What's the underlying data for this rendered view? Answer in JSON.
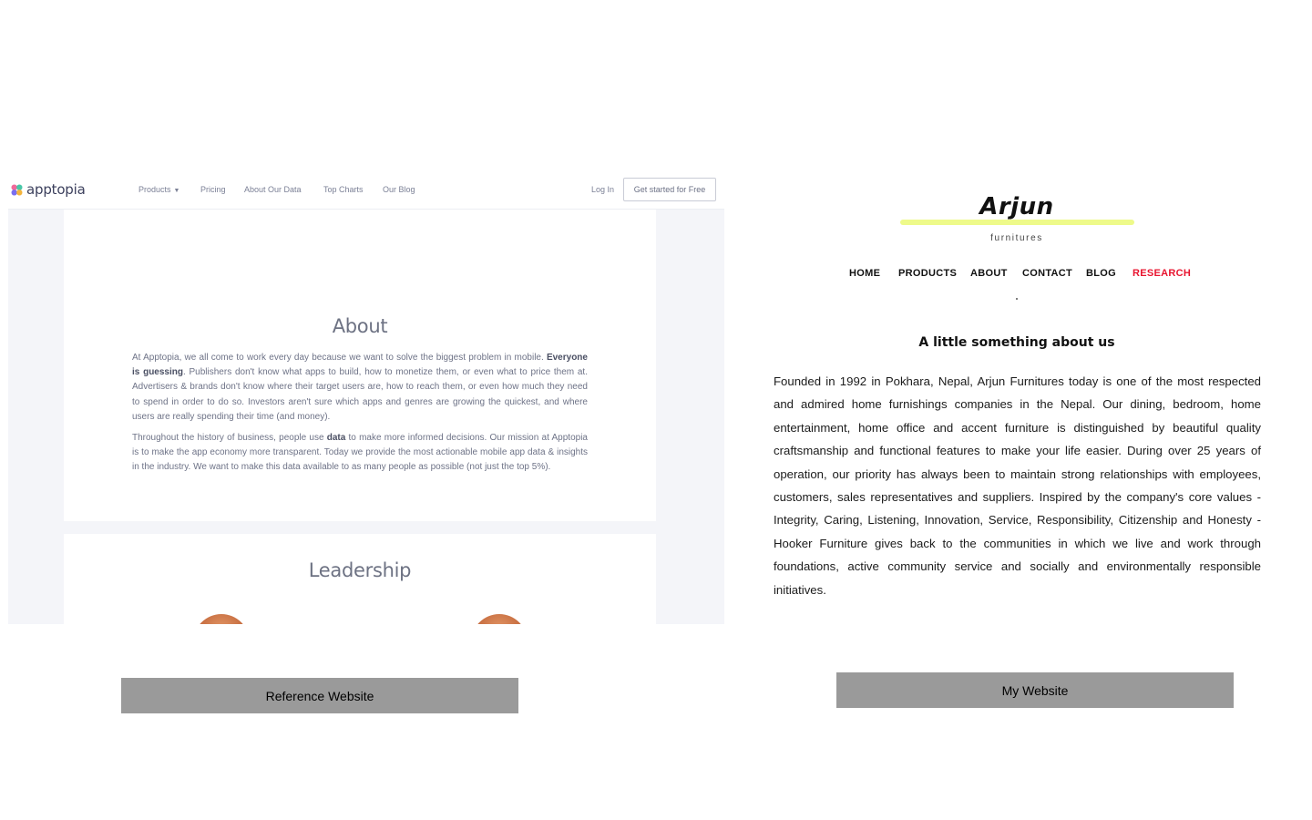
{
  "reference": {
    "logo_text": "apptopia",
    "nav": {
      "products": "Products",
      "pricing": "Pricing",
      "about_data": "About Our Data",
      "top_charts": "Top Charts",
      "blog": "Our Blog",
      "login": "Log In",
      "cta": "Get started for Free"
    },
    "about_title": "About",
    "para1_lead": "At Apptopia, we all come to work every day because we want to solve the biggest problem in mobile.",
    "para1_bold": "Everyone is guessing",
    "para1_rest": ". Publishers don't know what apps to build, how to monetize them, or even what to price them at. Advertisers & brands don't know where their target users are, how to reach them, or even how much they need to spend in order to do so. Investors aren't sure which apps and genres are growing the quickest, and where users are really spending their time (and money).",
    "para2_lead": "Throughout the history of business, people use",
    "para2_bold": "data",
    "para2_rest": "to make more informed decisions. Our mission at Apptopia is to make the app economy more transparent. Today we provide the most actionable mobile app data & insights in the industry. We want to make this data available to as many people as possible (not just the top 5%).",
    "leadership_title": "Leadership"
  },
  "labels": {
    "reference": "Reference Website",
    "mine": "My Website"
  },
  "mysite": {
    "brand": "Arjun",
    "tagline": "furnitures",
    "nav": [
      "HOME",
      "PRODUCTS",
      "ABOUT",
      "CONTACT",
      "BLOG",
      "RESEARCH"
    ],
    "heading": "A little something about us",
    "body": "Founded in 1992 in Pokhara, Nepal, Arjun Furnitures today is one of the most respected and admired home furnishings companies in the Nepal. Our dining, bedroom, home entertainment, home office and accent furniture is distinguished by beautiful quality craftsmanship and functional features to make your life easier. During over 25 years of operation, our priority has always been to maintain strong relationships with employees, customers, sales representatives and suppliers. Inspired by the company's core values - Integrity, Caring, Listening, Innovation, Service, Responsibility, Citizenship and Honesty - Hooker Furniture gives back to the communities in which we live and work through foundations, active community service and socially and environmentally responsible initiatives."
  },
  "colors": {
    "research_active": "#e8142f",
    "brand_highlight": "#eefa8a",
    "label_bg": "#9a9a9a"
  }
}
